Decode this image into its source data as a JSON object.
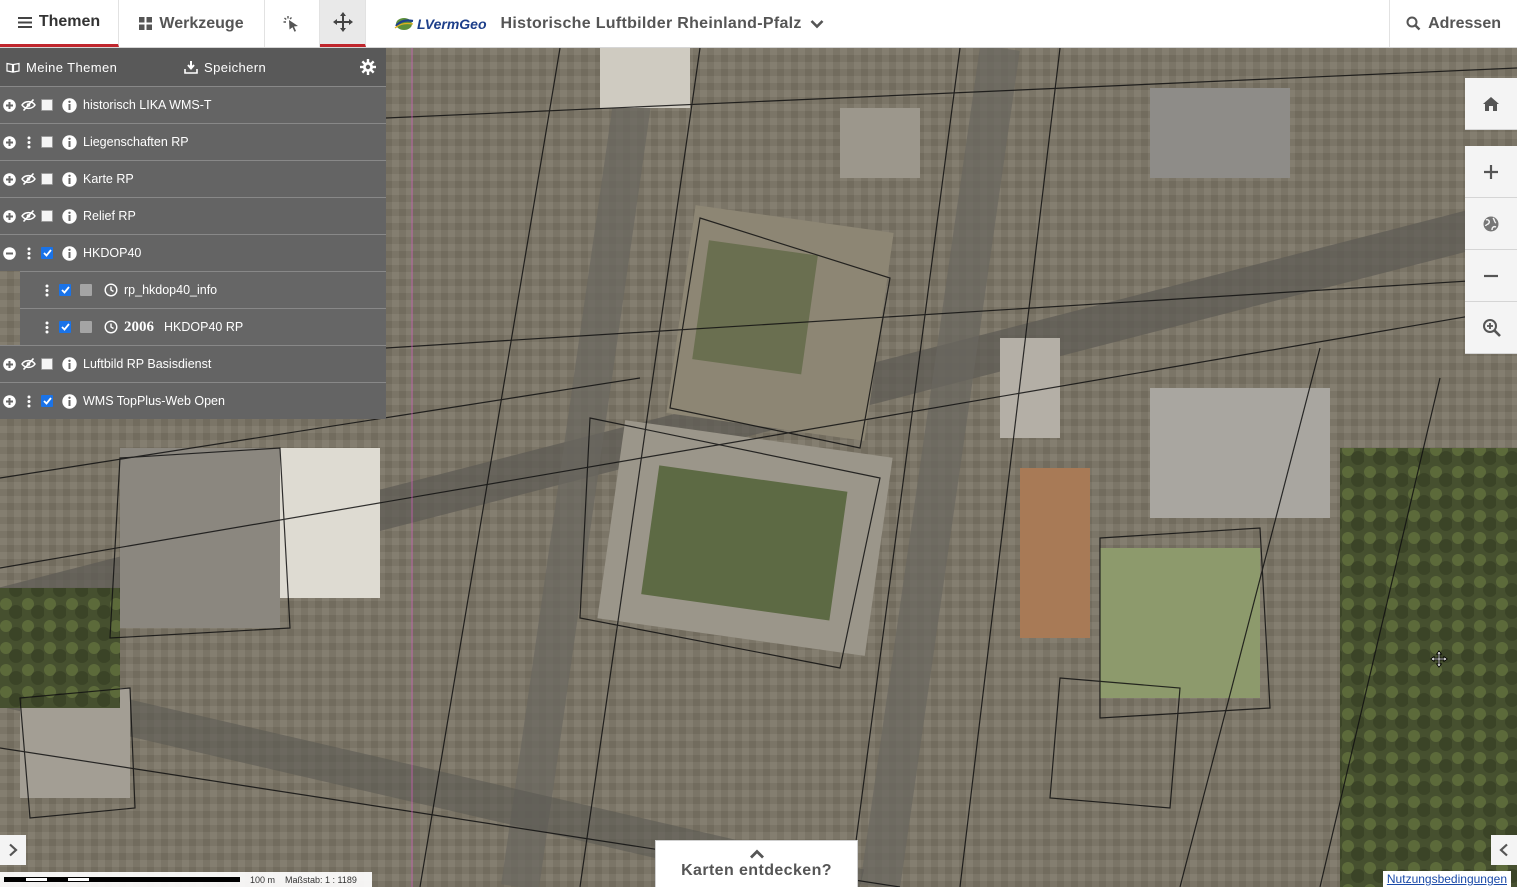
{
  "topbar": {
    "themes_label": "Themen",
    "tools_label": "Werkzeuge",
    "logo_text": "LVermGeo",
    "app_title": "Historische Luftbilder Rheinland-Pfalz",
    "address_label": "Adressen"
  },
  "panel": {
    "my_themes_label": "Meine Themen",
    "save_label": "Speichern",
    "layers": [
      {
        "label": "historisch LIKA WMS-T",
        "expand": "plus",
        "visibility": "hidden",
        "checked": false
      },
      {
        "label": "Liegenschaften RP",
        "expand": "plus",
        "visibility": "menu",
        "checked": false
      },
      {
        "label": "Karte RP",
        "expand": "plus",
        "visibility": "hidden",
        "checked": false
      },
      {
        "label": "Relief RP",
        "expand": "plus",
        "visibility": "hidden",
        "checked": false
      },
      {
        "label": "HKDOP40",
        "expand": "minus",
        "visibility": "menu",
        "checked": true
      },
      {
        "label": "rp_hkdop40_info",
        "sub": true,
        "checked": true
      },
      {
        "label": "HKDOP40 RP",
        "sub": true,
        "checked": true,
        "year": "2006"
      },
      {
        "label": "Luftbild RP Basisdienst",
        "expand": "plus",
        "visibility": "hidden",
        "checked": false
      },
      {
        "label": "WMS TopPlus-Web Open",
        "expand": "plus",
        "visibility": "menu",
        "checked": true
      }
    ]
  },
  "map_controls": [
    "home-icon",
    "zoom-in-icon",
    "globe-icon",
    "zoom-out-icon",
    "magnifier-plus-icon"
  ],
  "bottom": {
    "scale_distance": "100 m",
    "scale_ratio": "Maßstab: 1 : 1189",
    "discover_label": "Karten entdecken?",
    "terms_label": "Nutzungsbedingungen"
  },
  "colors": {
    "accent": "#c0262d",
    "panel_bg": "#646464",
    "check_blue": "#1a73e8",
    "logo_blue": "#1d3f8a"
  }
}
